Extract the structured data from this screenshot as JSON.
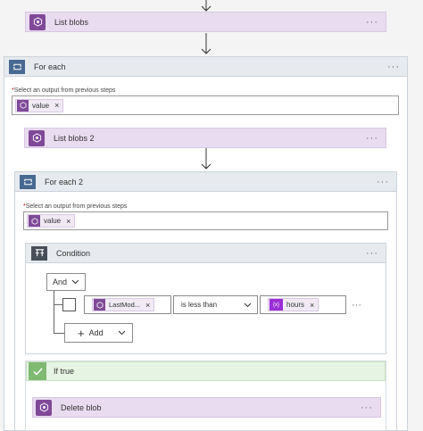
{
  "list_blobs": {
    "title": "List blobs",
    "more": "···"
  },
  "for_each": {
    "title": "For each",
    "more": "···",
    "select_label": "Select an output from previous steps",
    "required_mark": "*",
    "token": "value",
    "token_remove": "×"
  },
  "list_blobs_2": {
    "title": "List blobs 2",
    "more": "···"
  },
  "for_each_2": {
    "title": "For each 2",
    "more": "···",
    "select_label": "Select an output from previous steps",
    "required_mark": "*",
    "token": "value",
    "token_remove": "×"
  },
  "condition": {
    "title": "Condition",
    "more": "···",
    "operator": "And",
    "left_token": "LastMod...",
    "left_remove": "×",
    "comparison": "is less than",
    "right_token": "hours",
    "right_token_icon": "{x}",
    "right_remove": "×",
    "row_more": "···",
    "add_label": "Add",
    "add_plus": "+"
  },
  "if_true": {
    "title": "If true"
  },
  "delete_blob": {
    "title": "Delete blob",
    "more": "···"
  },
  "colors": {
    "purple": "#804998",
    "loop_blue": "#486991",
    "green": "#7fba72",
    "expression": "#9a2ed6"
  }
}
